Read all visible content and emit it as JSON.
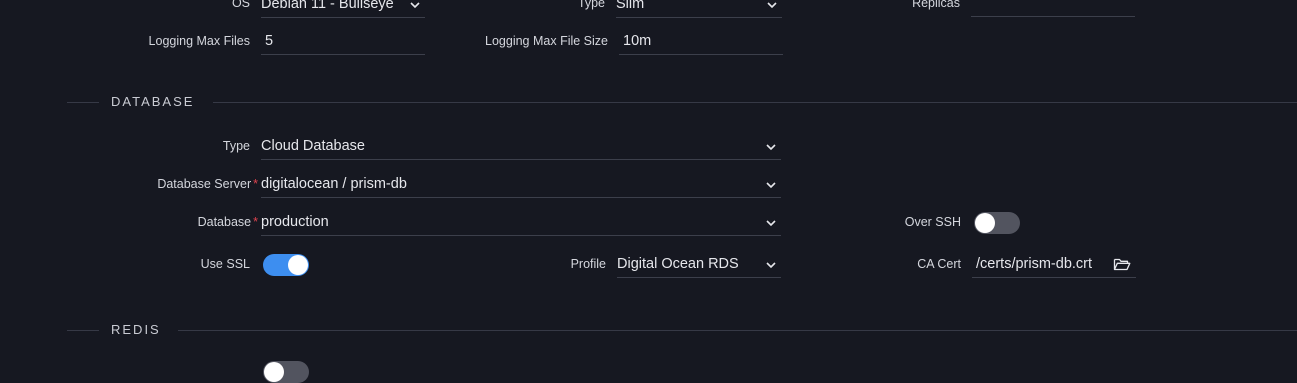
{
  "top": {
    "os": {
      "label": "OS",
      "value": "Debian 11 - Bullseye"
    },
    "type": {
      "label": "Type",
      "value": "Slim"
    },
    "replicas": {
      "label": "Replicas",
      "value": ""
    },
    "logging_max_files": {
      "label": "Logging Max Files",
      "value": "5"
    },
    "logging_max_file_size": {
      "label": "Logging Max File Size",
      "value": "10m"
    }
  },
  "database": {
    "title": "DATABASE",
    "type": {
      "label": "Type",
      "value": "Cloud Database"
    },
    "server": {
      "label": "Database Server",
      "value": "digitalocean / prism-db"
    },
    "db": {
      "label": "Database",
      "value": "production"
    },
    "over_ssh": {
      "label": "Over SSH",
      "on": false
    },
    "use_ssl": {
      "label": "Use SSL",
      "on": true
    },
    "profile": {
      "label": "Profile",
      "value": "Digital Ocean RDS"
    },
    "ca_cert": {
      "label": "CA Cert",
      "value": "/certs/prism-db.crt"
    }
  },
  "redis": {
    "title": "REDIS"
  },
  "colors": {
    "background": "#161821",
    "toggle_on": "#3d8ef0",
    "toggle_off": "#52545f",
    "required": "#e0444f"
  }
}
